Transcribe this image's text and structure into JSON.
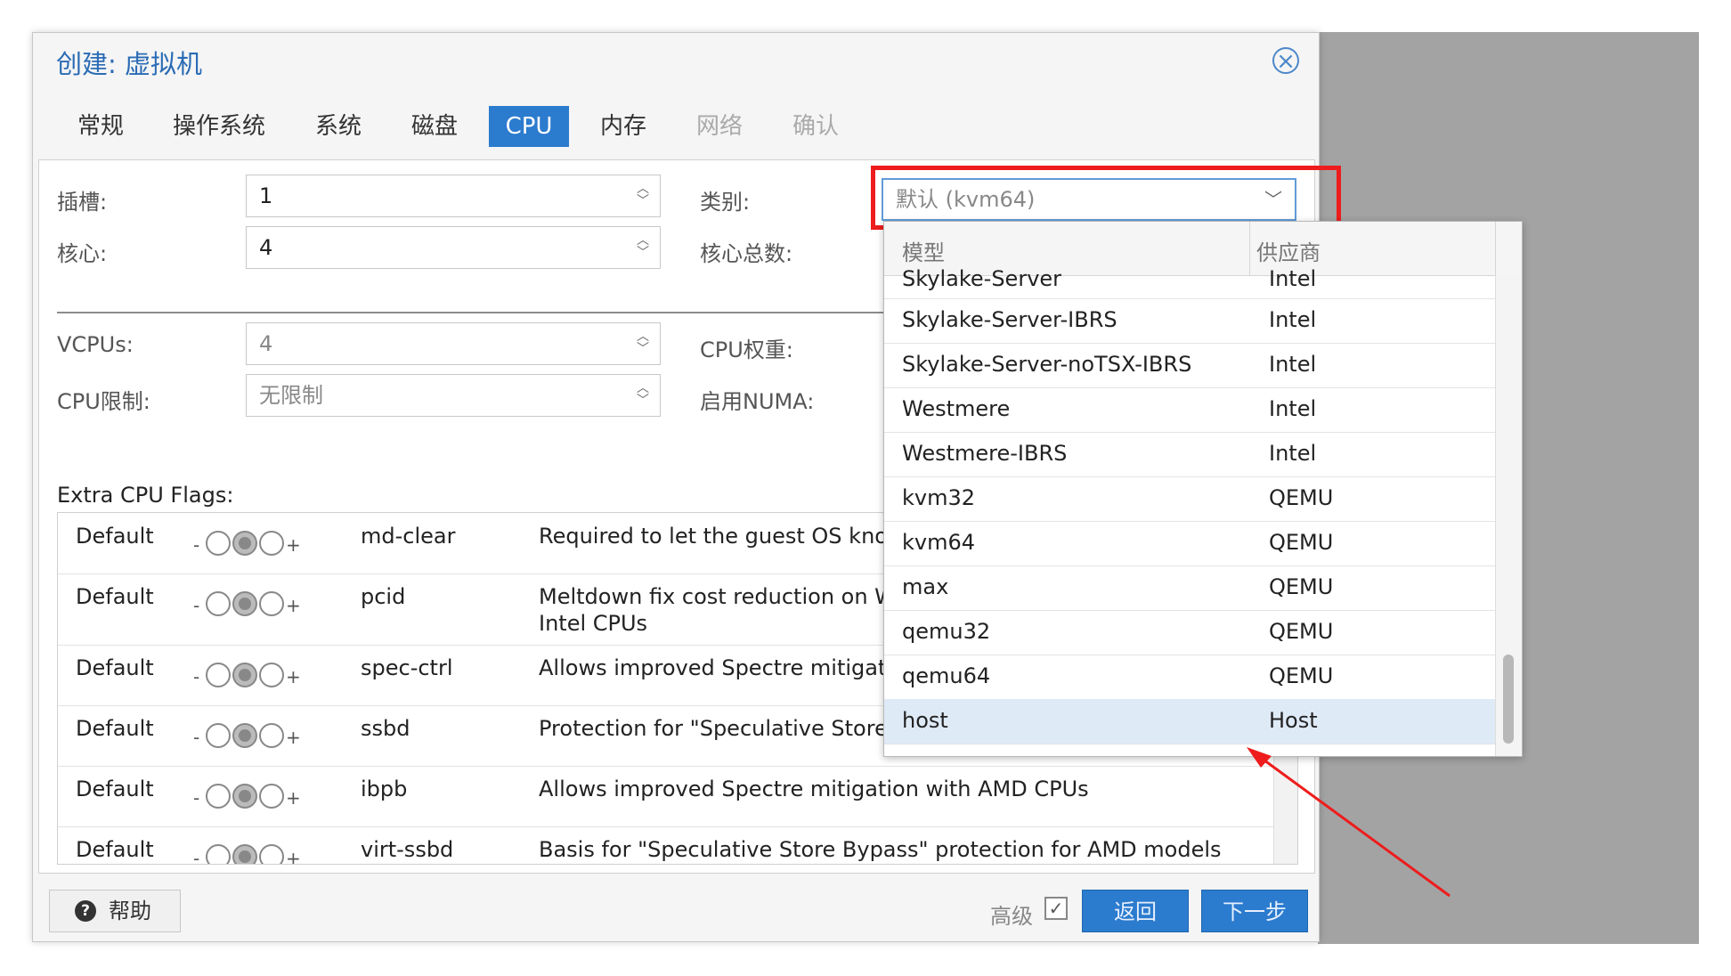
{
  "dialog": {
    "title": "创建: 虚拟机"
  },
  "tabs": [
    {
      "label": "常规"
    },
    {
      "label": "操作系统"
    },
    {
      "label": "系统"
    },
    {
      "label": "磁盘"
    },
    {
      "label": "CPU"
    },
    {
      "label": "内存"
    },
    {
      "label": "网络"
    },
    {
      "label": "确认"
    }
  ],
  "form": {
    "sockets_label": "插槽:",
    "sockets_value": "1",
    "cores_label": "核心:",
    "cores_value": "4",
    "type_label": "类别:",
    "type_value": "默认 (kvm64)",
    "total_cores_label": "核心总数:",
    "vcpus_label": "VCPUs:",
    "vcpus_value": "4",
    "cpu_weight_label": "CPU权重:",
    "cpu_limit_label": "CPU限制:",
    "cpu_limit_placeholder": "无限制",
    "numa_label": "启用NUMA:"
  },
  "flags": {
    "title": "Extra CPU Flags:",
    "minus": "-",
    "plus": "+",
    "rows": [
      {
        "state": "Default",
        "flag": "md-clear",
        "desc": "Required to let the guest OS know if MDS is mitigated correctly"
      },
      {
        "state": "Default",
        "flag": "pcid",
        "desc": "Meltdown fix cost reduction on Westmere, Sandy-, and IvyBridge",
        "desc2": "Intel CPUs"
      },
      {
        "state": "Default",
        "flag": "spec-ctrl",
        "desc": "Allows improved Spectre mitigation with Intel CPUs"
      },
      {
        "state": "Default",
        "flag": "ssbd",
        "desc": "Protection for \"Speculative Store Bypass\" for Intel models"
      },
      {
        "state": "Default",
        "flag": "ibpb",
        "desc": "Allows improved Spectre mitigation with AMD CPUs"
      },
      {
        "state": "Default",
        "flag": "virt-ssbd",
        "desc": "Basis for \"Speculative Store Bypass\" protection for AMD models"
      }
    ]
  },
  "dropdown": {
    "col_model": "模型",
    "col_vendor": "供应商",
    "items": [
      {
        "model": "Skylake-Server",
        "vendor": "Intel"
      },
      {
        "model": "Skylake-Server-IBRS",
        "vendor": "Intel"
      },
      {
        "model": "Skylake-Server-noTSX-IBRS",
        "vendor": "Intel"
      },
      {
        "model": "Westmere",
        "vendor": "Intel"
      },
      {
        "model": "Westmere-IBRS",
        "vendor": "Intel"
      },
      {
        "model": "kvm32",
        "vendor": "QEMU"
      },
      {
        "model": "kvm64",
        "vendor": "QEMU"
      },
      {
        "model": "max",
        "vendor": "QEMU"
      },
      {
        "model": "qemu32",
        "vendor": "QEMU"
      },
      {
        "model": "qemu64",
        "vendor": "QEMU"
      },
      {
        "model": "host",
        "vendor": "Host"
      }
    ],
    "selected": "host"
  },
  "footer": {
    "help": "帮助",
    "advanced": "高级",
    "back": "返回",
    "next": "下一步"
  },
  "colors": {
    "accent": "#2b7bce",
    "annotation": "#ee1c1c"
  }
}
